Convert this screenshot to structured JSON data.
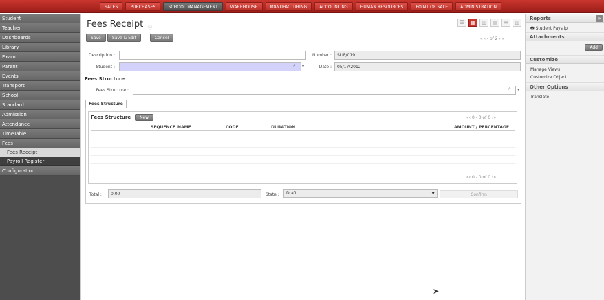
{
  "topmenu": [
    "SALES",
    "PURCHASES",
    "SCHOOL MANAGEMENT",
    "WAREHOUSE",
    "MANUFACTURING",
    "ACCOUNTING",
    "HUMAN RESOURCES",
    "POINT OF SALE",
    "ADMINISTRATION"
  ],
  "sidebar": {
    "items": [
      "Student",
      "Teacher",
      "Dashboards",
      "Library",
      "Exam",
      "Parent",
      "Events",
      "Transport",
      "School",
      "Standard",
      "Admission",
      "Attendance",
      "TimeTable",
      "Fees"
    ],
    "subitems": [
      "Fees Receipt",
      "Payroll Register"
    ],
    "last": "Configuration"
  },
  "form": {
    "title": "Fees Receipt",
    "save_label": "Save",
    "save_edit_label": "Save & Edit",
    "cancel_label": "Cancel",
    "pager_text": "« ‹ - of 2 › »",
    "description_label": "Description :",
    "description_value": "",
    "number_label": "Number :",
    "number_value": "SLIP/019",
    "student_label": "Student :",
    "student_value": "",
    "date_label": "Date :",
    "date_value": "05/17/2012",
    "section_title": "Fees Structure",
    "fees_structure_label": "Fees Structure :",
    "tab_label": "Fees Structure",
    "grid_title": "Fees Structure",
    "new_label": "New",
    "grid_pager": "0 - 0 of 0",
    "columns": [
      "SEQUENCE",
      "NAME",
      "CODE",
      "DURATION",
      "AMOUNT / PERCENTAGE"
    ],
    "total_label": "Total :",
    "total_value": "0.00",
    "state_label": "State :",
    "state_value": "Draft",
    "confirm_label": "Confirm"
  },
  "right": {
    "reports_title": "Reports",
    "reports_link": "Student Payslip",
    "attachments_title": "Attachments",
    "add_label": "Add",
    "customize_title": "Customize",
    "manage_views": "Manage Views",
    "customize_object": "Customize Object",
    "other_title": "Other Options",
    "translate": "Translate"
  }
}
